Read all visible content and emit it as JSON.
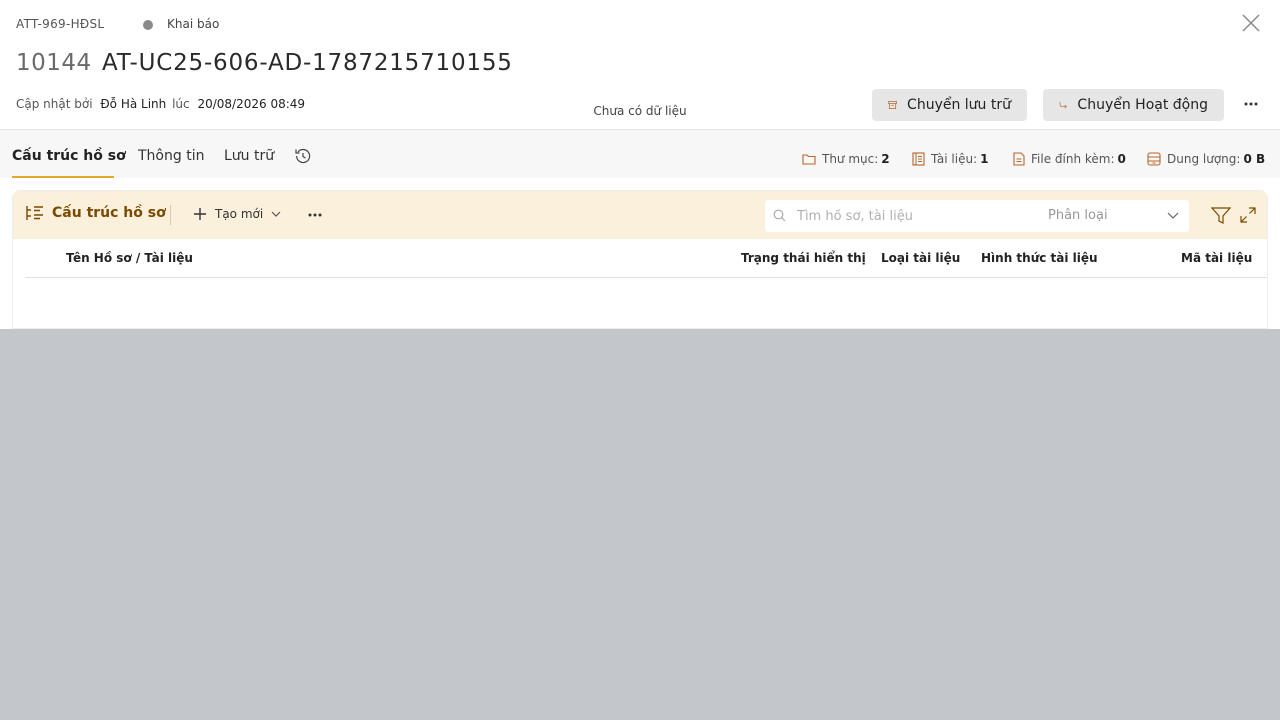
{
  "header": {
    "code": "ATT-969-HĐSL",
    "status": "Khai báo",
    "doc_number": "10144",
    "doc_title": "AT-UC25-606-AD-1787215710155",
    "updated_by_label": "Cập nhật bởi",
    "updated_by": "Đỗ Hà Linh",
    "at_label": "lúc",
    "updated_at": "20/08/2026 08:49",
    "archive_button": "Chuyển lưu trữ",
    "activity_button": "Chuyển Hoạt động"
  },
  "tabs": [
    {
      "label": "Cấu trúc hồ sơ",
      "active": true
    },
    {
      "label": "Thông tin"
    },
    {
      "label": "Lưu trữ"
    }
  ],
  "stats": [
    {
      "label": "Thư mục:",
      "value": "2",
      "icon": "folder-icon"
    },
    {
      "label": "Tài liệu:",
      "value": "1",
      "icon": "document-icon"
    },
    {
      "label": "File đính kèm:",
      "value": "0",
      "icon": "attachment-file-icon"
    },
    {
      "label": "Dung lượng:",
      "value": "0 B",
      "icon": "storage-icon"
    }
  ],
  "toolbar": {
    "title": "Cấu trúc hồ sơ",
    "create_label": "Tạo mới",
    "search_placeholder": "Tìm hồ sơ, tài liệu",
    "classify_placeholder": "Phân loại"
  },
  "table": {
    "columns": [
      "Tên Hồ sơ / Tài liệu",
      "Trạng thái hiển thị",
      "Loại tài liệu",
      "Hình thức tài liệu",
      "Mã tài liệu"
    ],
    "empty_text": "Chưa có dữ liệu"
  },
  "colors": {
    "accent": "#e5a728",
    "toolbar_bg": "#fbf0dc",
    "toolbar_text": "#7a4a00",
    "overlay": "#c3c6cb"
  }
}
